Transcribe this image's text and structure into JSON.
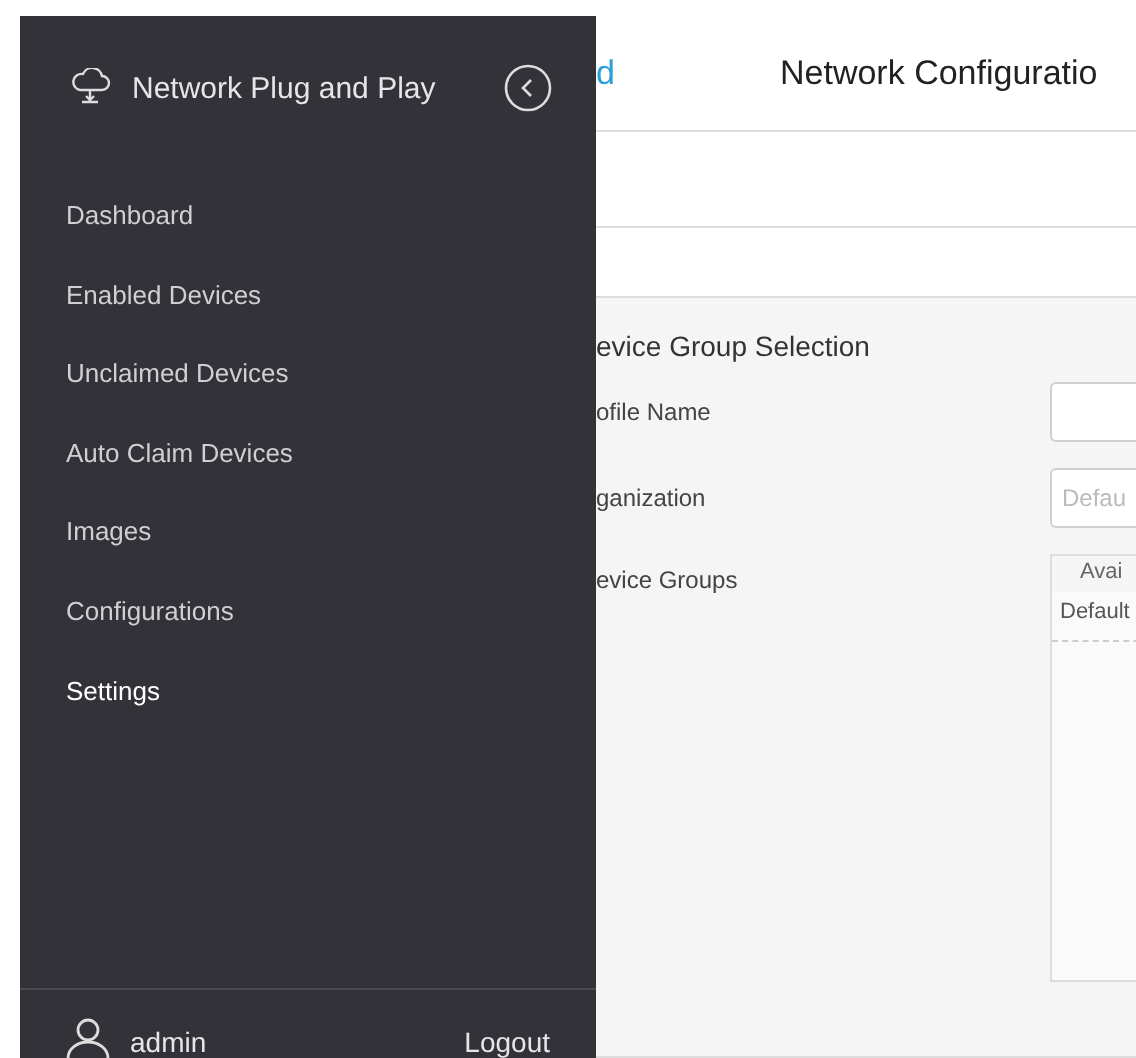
{
  "sidebar": {
    "title": "Network Plug and Play",
    "items": [
      {
        "label": "Dashboard",
        "selected": false
      },
      {
        "label": "Enabled Devices",
        "selected": false
      },
      {
        "label": "Unclaimed Devices",
        "selected": false
      },
      {
        "label": "Auto Claim Devices",
        "selected": false
      },
      {
        "label": "Images",
        "selected": false
      },
      {
        "label": "Configurations",
        "selected": false
      },
      {
        "label": "Settings",
        "selected": true
      }
    ],
    "user": "admin",
    "logout": "Logout"
  },
  "header": {
    "link": "d",
    "title": "Network Configuratio"
  },
  "form": {
    "section": "evice Group Selection",
    "profile_label": "ofile Name",
    "organization_label": "ganization",
    "organization_placeholder": "Defau",
    "groups_label": "evice Groups",
    "groups_header": "Avai",
    "groups_rows": [
      "Default"
    ]
  }
}
